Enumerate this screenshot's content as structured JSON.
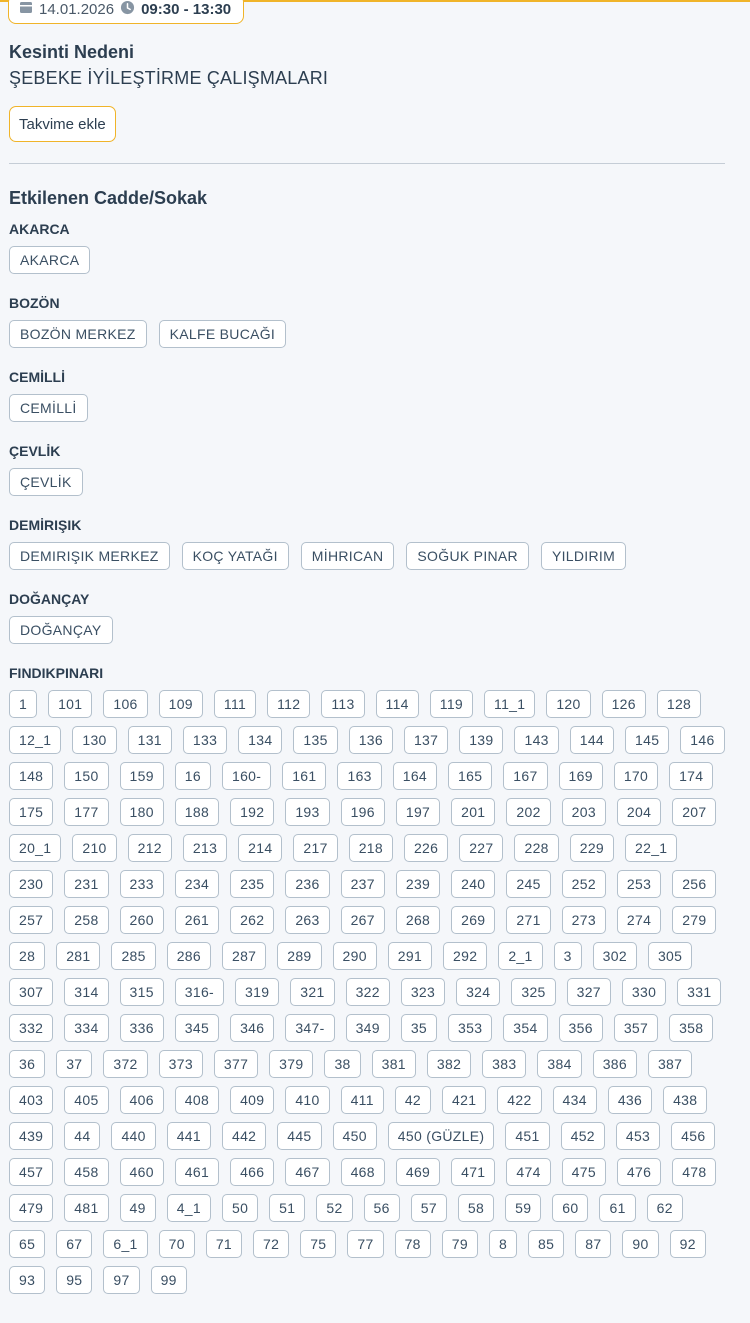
{
  "header": {
    "date": "14.01.2026",
    "time_range": "09:30 - 13:30",
    "accent_color": "#f0b429"
  },
  "reason": {
    "title": "Kesinti Nedeni",
    "text": "ŞEBEKE İYİLEŞTİRME ÇALIŞMALARI"
  },
  "calendar_button": {
    "label": "Takvime ekle"
  },
  "streets": {
    "title": "Etkilenen Cadde/Sokak",
    "groups": [
      {
        "name": "AKARCA",
        "items": [
          "AKARCA"
        ]
      },
      {
        "name": "BOZÖN",
        "items": [
          "BOZÖN MERKEZ",
          "KALFE BUCAĞI"
        ]
      },
      {
        "name": "CEMİLLİ",
        "items": [
          "CEMİLLİ"
        ]
      },
      {
        "name": "ÇEVLİK",
        "items": [
          "ÇEVLİK"
        ]
      },
      {
        "name": "DEMİRIŞIK",
        "items": [
          "DEMIRIŞIK MERKEZ",
          "KOÇ YATAĞI",
          "MİHRICAN",
          "SOĞUK PINAR",
          "YILDIRIM"
        ]
      },
      {
        "name": "DOĞANÇAY",
        "items": [
          "DOĞANÇAY"
        ]
      },
      {
        "name": "FINDIKPINARI",
        "numeric": true,
        "items": [
          "1",
          "101",
          "106",
          "109",
          "111",
          "112",
          "113",
          "114",
          "119",
          "11_1",
          "120",
          "126",
          "128",
          "12_1",
          "130",
          "131",
          "133",
          "134",
          "135",
          "136",
          "137",
          "139",
          "143",
          "144",
          "145",
          "146",
          "148",
          "150",
          "159",
          "16",
          "160-",
          "161",
          "163",
          "164",
          "165",
          "167",
          "169",
          "170",
          "174",
          "175",
          "177",
          "180",
          "188",
          "192",
          "193",
          "196",
          "197",
          "201",
          "202",
          "203",
          "204",
          "207",
          "20_1",
          "210",
          "212",
          "213",
          "214",
          "217",
          "218",
          "226",
          "227",
          "228",
          "229",
          "22_1",
          "230",
          "231",
          "233",
          "234",
          "235",
          "236",
          "237",
          "239",
          "240",
          "245",
          "252",
          "253",
          "256",
          "257",
          "258",
          "260",
          "261",
          "262",
          "263",
          "267",
          "268",
          "269",
          "271",
          "273",
          "274",
          "279",
          "28",
          "281",
          "285",
          "286",
          "287",
          "289",
          "290",
          "291",
          "292",
          "2_1",
          "3",
          "302",
          "305",
          "307",
          "314",
          "315",
          "316-",
          "319",
          "321",
          "322",
          "323",
          "324",
          "325",
          "327",
          "330",
          "331",
          "332",
          "334",
          "336",
          "345",
          "346",
          "347-",
          "349",
          "35",
          "353",
          "354",
          "356",
          "357",
          "358",
          "36",
          "37",
          "372",
          "373",
          "377",
          "379",
          "38",
          "381",
          "382",
          "383",
          "384",
          "386",
          "387",
          "403",
          "405",
          "406",
          "408",
          "409",
          "410",
          "411",
          "42",
          "421",
          "422",
          "434",
          "436",
          "438",
          "439",
          "44",
          "440",
          "441",
          "442",
          "445",
          "450",
          "450 (GÜZLE)",
          "451",
          "452",
          "453",
          "456",
          "457",
          "458",
          "460",
          "461",
          "466",
          "467",
          "468",
          "469",
          "471",
          "474",
          "475",
          "476",
          "478",
          "479",
          "481",
          "49",
          "4_1",
          "50",
          "51",
          "52",
          "56",
          "57",
          "58",
          "59",
          "60",
          "61",
          "62",
          "65",
          "67",
          "6_1",
          "70",
          "71",
          "72",
          "75",
          "77",
          "78",
          "79",
          "8",
          "85",
          "87",
          "90",
          "92",
          "93",
          "95",
          "97",
          "99"
        ]
      }
    ]
  }
}
